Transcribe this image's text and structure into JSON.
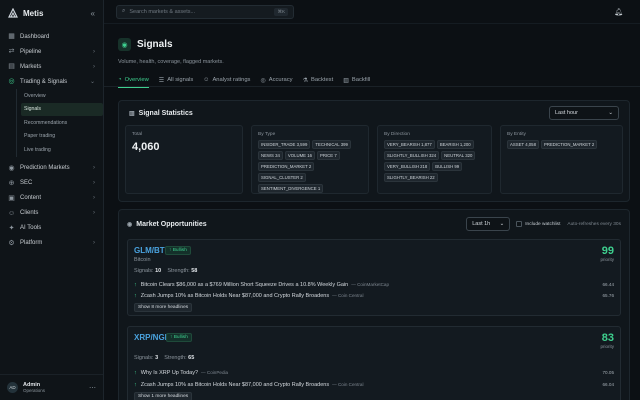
{
  "app": {
    "name": "Metis",
    "collapse_glyph": "«"
  },
  "sidebar": {
    "items": [
      {
        "label": "Dashboard",
        "icon": "grid-icon",
        "glyph": "▦",
        "chevron": false
      },
      {
        "label": "Pipeline",
        "icon": "pipeline-icon",
        "glyph": "⇄",
        "chevron": true
      },
      {
        "label": "Markets",
        "icon": "markets-icon",
        "glyph": "▤",
        "chevron": true
      },
      {
        "label": "Trading & Signals",
        "icon": "signal-icon",
        "glyph": "◎",
        "chevron": true,
        "expanded": true
      }
    ],
    "sub_items": [
      {
        "label": "Overview",
        "active": false
      },
      {
        "label": "Signals",
        "active": true
      },
      {
        "label": "Recommendations",
        "active": false
      },
      {
        "label": "Paper trading",
        "active": false
      },
      {
        "label": "Live trading",
        "active": false
      }
    ],
    "items_after": [
      {
        "label": "Prediction Markets",
        "icon": "prediction-icon",
        "glyph": "◉",
        "chevron": true
      },
      {
        "label": "SEC",
        "icon": "sec-icon",
        "glyph": "⊕",
        "chevron": true
      },
      {
        "label": "Content",
        "icon": "content-icon",
        "glyph": "▣",
        "chevron": true
      },
      {
        "label": "Clients",
        "icon": "clients-icon",
        "glyph": "☺",
        "chevron": true
      },
      {
        "label": "AI Tools",
        "icon": "ai-icon",
        "glyph": "✦",
        "chevron": false
      },
      {
        "label": "Platform",
        "icon": "platform-icon",
        "glyph": "⚙",
        "chevron": true
      }
    ],
    "user": {
      "initials": "AD",
      "name": "Admin",
      "role": "Operations"
    }
  },
  "topbar": {
    "search_placeholder": "Search markets & assets...",
    "shortcut": "⌘K"
  },
  "page": {
    "title": "Signals",
    "subtitle": "Volume, health, coverage, flagged markets."
  },
  "tabs": [
    {
      "label": "Overview",
      "active": true,
      "glyph": "◔"
    },
    {
      "label": "All signals",
      "active": false,
      "glyph": "☰"
    },
    {
      "label": "Analyst ratings",
      "active": false,
      "glyph": "☺"
    },
    {
      "label": "Accuracy",
      "active": false,
      "glyph": "◎"
    },
    {
      "label": "Backtest",
      "active": false,
      "glyph": "⚗"
    },
    {
      "label": "Backfill",
      "active": false,
      "glyph": "▥"
    }
  ],
  "stats": {
    "title": "Signal Statistics",
    "period": "Last hour",
    "total_label": "Total",
    "total_value": "4,060",
    "by_type_label": "By Type",
    "by_type": [
      "INSIDER_TRADE 3,599",
      "TECHNICAL 399",
      "NEWS 34",
      "VOLUME 16",
      "PRICE 7",
      "PREDICTION_MARKET 2",
      "SIGNAL_CLUSTER 2",
      "SENTIMENT_DIVERGENCE 1"
    ],
    "by_direction_label": "By Direction",
    "by_direction": [
      "VERY_BEARISH 1,877",
      "BEARISH 1,200",
      "SLIGHTLY_BULLISH 324",
      "NEUTRAL 320",
      "VERY_BULLISH 218",
      "BULLISH 99",
      "SLIGHTLY_BEARISH 22"
    ],
    "by_entity_label": "By Entity",
    "by_entity": [
      "ASSET 4,058",
      "PREDICTION_MARKET 2"
    ]
  },
  "market": {
    "title": "Market Opportunities",
    "period": "Last 1h",
    "watchlist_label": "Include watchlist",
    "auto_refresh": "Auto-refreshes every 30s",
    "opportunities": [
      {
        "symbol": "GLM/BTC",
        "badge": "Bullish",
        "quote": "Bitcoin",
        "signals_label": "Signals:",
        "signals": "10",
        "strength_label": "Strength:",
        "strength": "58",
        "priority": "99",
        "priority_label": "priority",
        "headlines": [
          {
            "text": "Bitcoin Clears $86,000 as a $769 Million Short Squeeze Drives a 10.8% Weekly Gain",
            "source": "— CoinMarketCap",
            "score": "66.44"
          },
          {
            "text": "Zcash Jumps 10% as Bitcoin Holds Near $87,000 and Crypto Rally Broadens",
            "source": "— Coin Central",
            "score": "65.76"
          }
        ],
        "more": "Show 8 more headlines"
      },
      {
        "symbol": "XRP/NGN",
        "badge": "Bullish",
        "quote": "",
        "signals_label": "Signals:",
        "signals": "3",
        "strength_label": "Strength:",
        "strength": "65",
        "priority": "83",
        "priority_label": "priority",
        "headlines": [
          {
            "text": "Why Is XRP Up Today?",
            "source": "— CoinPedia",
            "score": "70.05"
          },
          {
            "text": "Zcash Jumps 10% as Bitcoin Holds Near $87,000 and Crypto Rally Broadens",
            "source": "— Coin Central",
            "score": "66.04"
          }
        ],
        "more": "Show 1 more headlines"
      }
    ]
  },
  "colors": {
    "accent": "#3ecf8e",
    "link": "#4aa3df",
    "background": "#0c1014"
  }
}
